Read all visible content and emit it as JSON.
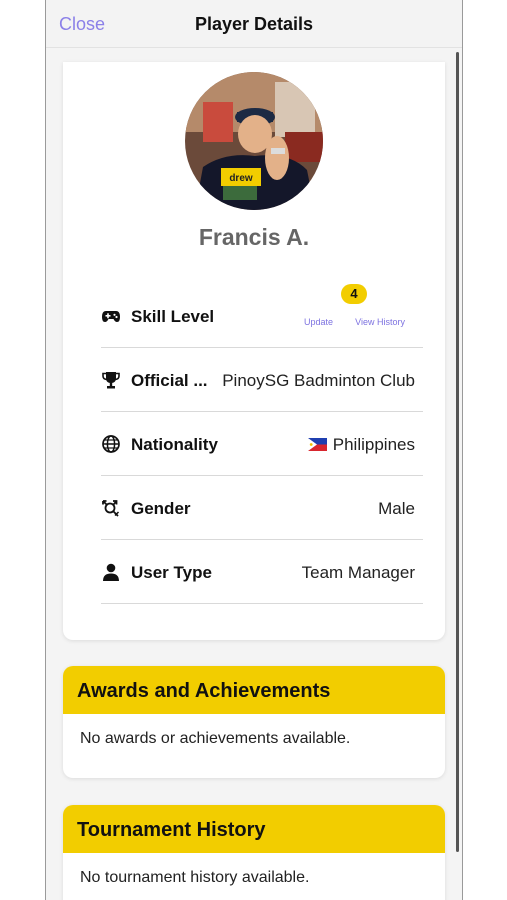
{
  "navbar": {
    "close_label": "Close",
    "title": "Player Details"
  },
  "profile": {
    "name": "Francis A.",
    "avatar_shirt_text": "drew"
  },
  "skill": {
    "label": "Skill Level",
    "level": "4",
    "update_label": "Update",
    "history_label": "View History"
  },
  "details": [
    {
      "key": "official",
      "icon": "trophy-icon",
      "label": "Official ...",
      "value": "PinoySG Badminton Club"
    },
    {
      "key": "nationality",
      "icon": "globe-icon",
      "label": "Nationality",
      "value": "Philippines",
      "flag": "philippines-flag"
    },
    {
      "key": "gender",
      "icon": "gender-icon",
      "label": "Gender",
      "value": "Male"
    },
    {
      "key": "user-type",
      "icon": "person-icon",
      "label": "User Type",
      "value": "Team Manager"
    }
  ],
  "awards": {
    "title": "Awards and Achievements",
    "empty_text": "No awards or achievements available."
  },
  "tournaments": {
    "title": "Tournament History",
    "empty_text": "No tournament history available."
  },
  "colors": {
    "accent": "#8b80e8",
    "section_header": "#f2cd00",
    "badge": "#f2cd00"
  }
}
